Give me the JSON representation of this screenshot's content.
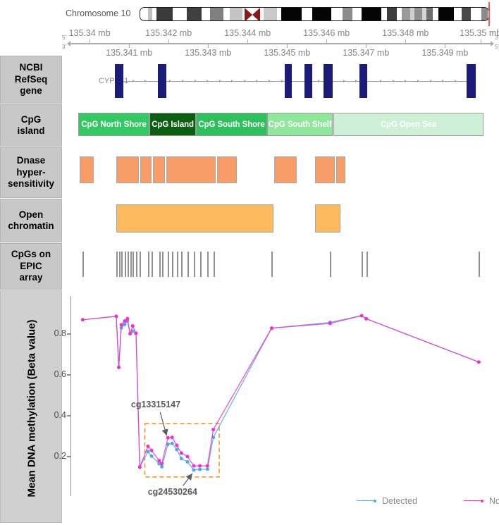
{
  "sidebar": {
    "items": [
      {
        "key": "gene",
        "label": "NCBI\nRefSeq\ngene"
      },
      {
        "key": "cpg",
        "label": "CpG\nisland"
      },
      {
        "key": "dnase",
        "label": "Dnase\nhyper-\nsensitivity"
      },
      {
        "key": "chromatin",
        "label": "Open\nchromatin"
      },
      {
        "key": "epic",
        "label": "CpGs on\nEPIC\narray"
      }
    ],
    "plot_axis_title": "Mean DNA methylation (Beta value)"
  },
  "ideogram": {
    "label": "Chromosome 10",
    "bands": [
      {
        "start": 0.0,
        "end": 0.022,
        "color": "#ffffff"
      },
      {
        "start": 0.022,
        "end": 0.034,
        "color": "#bfbfbf"
      },
      {
        "start": 0.034,
        "end": 0.046,
        "color": "#ffffff"
      },
      {
        "start": 0.046,
        "end": 0.092,
        "color": "#3a3a3a"
      },
      {
        "start": 0.092,
        "end": 0.134,
        "color": "#ffffff"
      },
      {
        "start": 0.134,
        "end": 0.176,
        "color": "#3f3f3f"
      },
      {
        "start": 0.176,
        "end": 0.2,
        "color": "#ffffff"
      },
      {
        "start": 0.2,
        "end": 0.238,
        "color": "#808080"
      },
      {
        "start": 0.238,
        "end": 0.256,
        "color": "#ffffff"
      },
      {
        "start": 0.256,
        "end": 0.292,
        "color": "#c4c4c4"
      },
      {
        "start": 0.292,
        "end": 0.306,
        "color": "#ffffff"
      },
      {
        "start": 0.334,
        "end": 0.352,
        "color": "#ffffff"
      },
      {
        "start": 0.352,
        "end": 0.392,
        "color": "#c9c9c9"
      },
      {
        "start": 0.392,
        "end": 0.404,
        "color": "#ffffff"
      },
      {
        "start": 0.404,
        "end": 0.462,
        "color": "#050505"
      },
      {
        "start": 0.462,
        "end": 0.492,
        "color": "#ffffff"
      },
      {
        "start": 0.492,
        "end": 0.546,
        "color": "#050505"
      },
      {
        "start": 0.546,
        "end": 0.578,
        "color": "#ffffff"
      },
      {
        "start": 0.578,
        "end": 0.606,
        "color": "#8c8c8c"
      },
      {
        "start": 0.606,
        "end": 0.634,
        "color": "#ffffff"
      },
      {
        "start": 0.634,
        "end": 0.69,
        "color": "#050505"
      },
      {
        "start": 0.69,
        "end": 0.706,
        "color": "#ffffff"
      },
      {
        "start": 0.706,
        "end": 0.734,
        "color": "#3d3d3d"
      },
      {
        "start": 0.734,
        "end": 0.748,
        "color": "#ffffff"
      },
      {
        "start": 0.748,
        "end": 0.772,
        "color": "#9a9a9a"
      },
      {
        "start": 0.772,
        "end": 0.784,
        "color": "#cfcfcf"
      },
      {
        "start": 0.784,
        "end": 0.806,
        "color": "#8f8f8f"
      },
      {
        "start": 0.806,
        "end": 0.818,
        "color": "#d6d6d6"
      },
      {
        "start": 0.818,
        "end": 0.836,
        "color": "#6d6d6d"
      },
      {
        "start": 0.836,
        "end": 0.852,
        "color": "#ffffff"
      },
      {
        "start": 0.852,
        "end": 0.898,
        "color": "#050505"
      },
      {
        "start": 0.898,
        "end": 0.92,
        "color": "#ffffff"
      },
      {
        "start": 0.92,
        "end": 0.946,
        "color": "#4a4a4a"
      },
      {
        "start": 0.946,
        "end": 0.962,
        "color": "#ffffff"
      },
      {
        "start": 0.962,
        "end": 0.976,
        "color": "#ffffff"
      },
      {
        "start": 0.976,
        "end": 0.994,
        "color": "#8a8a8a"
      },
      {
        "start": 0.994,
        "end": 1.0,
        "color": "#ffffff"
      }
    ],
    "centromere": {
      "position": 0.32,
      "color": "#8f1616"
    },
    "marker_position": 0.9985,
    "marker_color": "#f05a5a"
  },
  "axis": {
    "strand_left_top": "5'",
    "strand_left_bottom": "3'",
    "strand_right_top": "3'",
    "strand_right_bottom": "5'",
    "top_labels": [
      {
        "pos": 0.0455,
        "text": "135.34 mb"
      },
      {
        "pos": 0.2335,
        "text": "135.342 mb"
      },
      {
        "pos": 0.4215,
        "text": "135.344 mb"
      },
      {
        "pos": 0.6095,
        "text": "135.346 mb"
      },
      {
        "pos": 0.7975,
        "text": "135.348 mb"
      },
      {
        "pos": 0.976,
        "text": "135.35 mb"
      }
    ],
    "bottom_labels": [
      {
        "pos": 0.1395,
        "text": "135.341 mb"
      },
      {
        "pos": 0.3275,
        "text": "135.343 mb"
      },
      {
        "pos": 0.5155,
        "text": "135.345 mb"
      },
      {
        "pos": 0.7035,
        "text": "135.347 mb"
      },
      {
        "pos": 0.8915,
        "text": "135.349 mb"
      }
    ]
  },
  "gene": {
    "name": "CYP2E1",
    "strand": "forward",
    "body_start": 0.1055,
    "body_end": 0.964,
    "exons": [
      {
        "start": 0.1055,
        "end": 0.1265
      },
      {
        "start": 0.208,
        "end": 0.229
      },
      {
        "start": 0.5095,
        "end": 0.5275
      },
      {
        "start": 0.5575,
        "end": 0.576
      },
      {
        "start": 0.602,
        "end": 0.625
      },
      {
        "start": 0.688,
        "end": 0.707
      },
      {
        "start": 0.943,
        "end": 0.964
      }
    ]
  },
  "cpg_island": {
    "blocks": [
      {
        "label": "CpG North Shore",
        "start": 0.0185,
        "end": 0.188,
        "color": "#33c863"
      },
      {
        "label": "CpG Island",
        "start": 0.188,
        "end": 0.299,
        "color": "#0b5e12"
      },
      {
        "label": "CpG South Shore",
        "start": 0.299,
        "end": 0.468,
        "color": "#2ec05c"
      },
      {
        "label": "CpG South Shelf",
        "start": 0.468,
        "end": 0.625,
        "color": "#8ee79a"
      },
      {
        "label": "CpG Open Sea",
        "start": 0.625,
        "end": 0.984,
        "color": "#cdf0d6"
      }
    ]
  },
  "dnase": {
    "color": "#f99d68",
    "regions": [
      {
        "start": 0.0225,
        "end": 0.056
      },
      {
        "start": 0.109,
        "end": 0.1625
      },
      {
        "start": 0.166,
        "end": 0.193
      },
      {
        "start": 0.1965,
        "end": 0.225
      },
      {
        "start": 0.229,
        "end": 0.345
      },
      {
        "start": 0.349,
        "end": 0.396
      },
      {
        "start": 0.485,
        "end": 0.539
      },
      {
        "start": 0.583,
        "end": 0.629
      },
      {
        "start": 0.633,
        "end": 0.654
      }
    ]
  },
  "open_chromatin": {
    "color": "#fcba5e",
    "regions": [
      {
        "start": 0.109,
        "end": 0.484
      },
      {
        "start": 0.583,
        "end": 0.642
      }
    ]
  },
  "epic_cpgs": {
    "color": "#919191",
    "positions": [
      0.029,
      0.109,
      0.115,
      0.121,
      0.129,
      0.1355,
      0.142,
      0.148,
      0.156,
      0.165,
      0.1845,
      0.193,
      0.211,
      0.2175,
      0.232,
      0.242,
      0.253,
      0.264,
      0.2785,
      0.2935,
      0.308,
      0.326,
      0.34,
      0.479,
      0.618,
      0.693,
      0.704,
      0.972
    ]
  },
  "chart_data": {
    "type": "line",
    "title": "",
    "xlabel": "",
    "ylabel": "Mean DNA methylation (Beta value)",
    "ylim": [
      0.08,
      0.95
    ],
    "yticks": [
      0.2,
      0.4,
      0.6,
      0.8
    ],
    "ytick_labels": [
      "0.2",
      "0.4",
      "0.6",
      "0.8"
    ],
    "xlim": [
      0.0,
      1.0
    ],
    "grid": false,
    "legend_position": "bottom-right",
    "x": [
      0.029,
      0.109,
      0.115,
      0.121,
      0.129,
      0.1355,
      0.142,
      0.148,
      0.156,
      0.165,
      0.1845,
      0.193,
      0.211,
      0.2175,
      0.232,
      0.242,
      0.253,
      0.264,
      0.2785,
      0.2935,
      0.308,
      0.326,
      0.34,
      0.479,
      0.618,
      0.693,
      0.704,
      0.972
    ],
    "series": [
      {
        "name": "Detected",
        "color": "#4fa8e8",
        "values": [
          0.868,
          0.885,
          0.635,
          0.828,
          0.845,
          0.862,
          0.8,
          0.812,
          0.802,
          0.146,
          0.222,
          0.2,
          0.163,
          0.148,
          0.258,
          0.262,
          0.232,
          0.188,
          0.172,
          0.132,
          0.135,
          0.136,
          0.292,
          0.827,
          0.855,
          0.888,
          0.873,
          0.661
        ]
      },
      {
        "name": "Not_Detected",
        "color": "#ee33cc",
        "values": [
          0.868,
          0.885,
          0.635,
          0.843,
          0.862,
          0.873,
          0.8,
          0.838,
          0.802,
          0.146,
          0.248,
          0.228,
          0.178,
          0.163,
          0.29,
          0.292,
          0.253,
          0.215,
          0.198,
          0.152,
          0.152,
          0.152,
          0.33,
          0.827,
          0.85,
          0.888,
          0.873,
          0.661
        ]
      }
    ],
    "annotations": [
      {
        "label": "cg13315147",
        "x": 0.232,
        "y": 0.258
      },
      {
        "label": "cg24530264",
        "x": 0.2935,
        "y": 0.132
      }
    ],
    "highlight_box": {
      "x_start": 0.177,
      "x_end": 0.354,
      "y_top": 0.36,
      "y_bottom": 0.098,
      "color": "#f0952e",
      "style": "dashed"
    },
    "legend": [
      {
        "label": "Detected",
        "color": "#4fa8e8"
      },
      {
        "label": "Not_Detected",
        "color": "#ee33cc"
      }
    ]
  }
}
